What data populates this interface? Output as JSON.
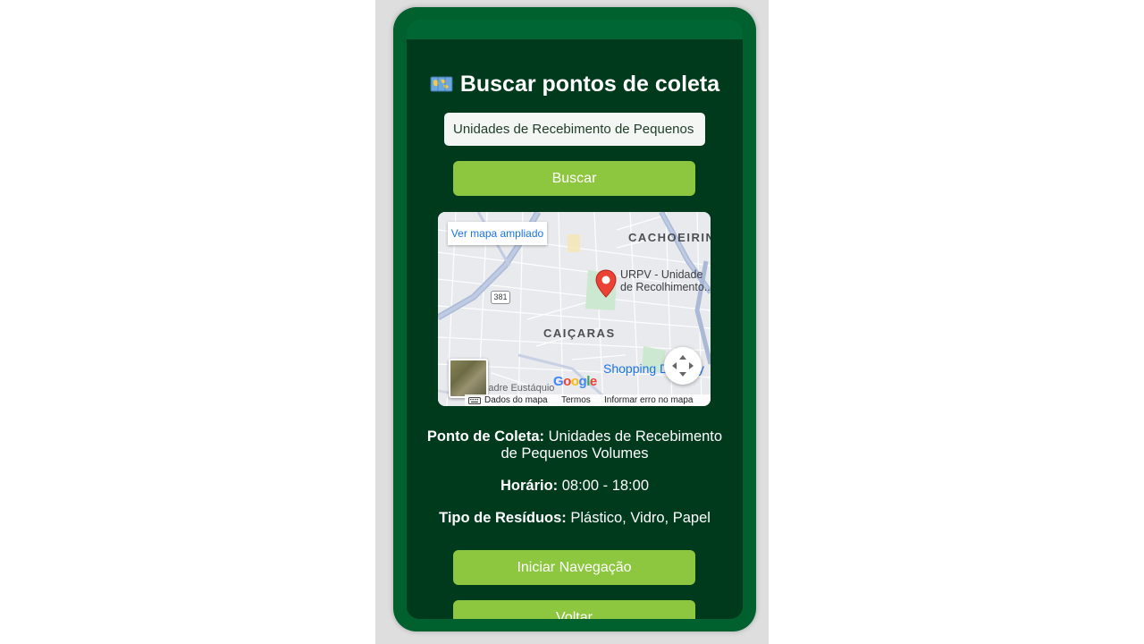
{
  "page": {
    "title": "Buscar pontos de coleta",
    "title_icon": "world-map-emoji"
  },
  "search": {
    "value": "Unidades de Recebimento de Pequenos Volumes",
    "button_label": "Buscar"
  },
  "map": {
    "expand_link": "Ver mapa ampliado",
    "labels": {
      "district_top": "CACHOEIRINHA",
      "district_center": "CAIÇARAS",
      "place_line1": "URPV - Unidade",
      "place_line2": "de Recolhimento...",
      "shopping": "Shopping Del Rey",
      "street": "R. Padre Eustáquio",
      "road_number": "381",
      "google": "Google"
    },
    "footer": {
      "data_label": "Dados do mapa",
      "terms_label": "Termos",
      "report_label": "Informar erro no mapa"
    }
  },
  "details": {
    "ponto_label": "Ponto de Coleta:",
    "ponto_value": "Unidades de Recebimento de Pequenos Volumes",
    "horario_label": "Horário:",
    "horario_value": "08:00 - 18:00",
    "tipo_label": "Tipo de Resíduos:",
    "tipo_value": "Plástico, Vidro, Papel"
  },
  "actions": {
    "navigate_label": "Iniciar Navegação",
    "back_label": "Voltar"
  },
  "colors": {
    "frame": "#00602e",
    "screen_bg": "#003a1c",
    "button": "#8dc63f",
    "text": "#ffffff"
  }
}
